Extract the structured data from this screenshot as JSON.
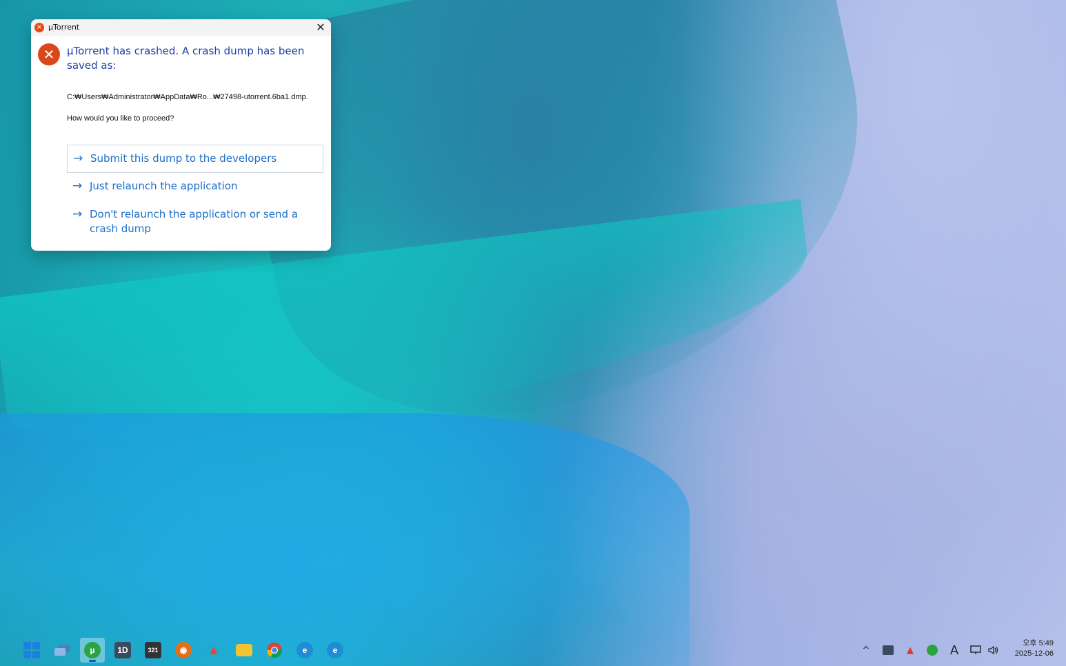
{
  "dialog": {
    "window_title": "µTorrent",
    "close_glyph": "✕",
    "heading": "µTorrent has crashed. A crash dump has been saved as:",
    "dump_path": "C:₩Users₩Administrator₩AppData₩Ro...₩27498-utorrent.6ba1.dmp.",
    "question": "How would you like to proceed?",
    "commands": [
      {
        "label": "Submit this dump to the developers"
      },
      {
        "label": "Just relaunch the application"
      },
      {
        "label": "Don't relaunch the application or send a crash dump"
      }
    ]
  },
  "taskbar": {
    "apps": [
      {
        "name": "start-menu-icon"
      },
      {
        "name": "task-view-icon"
      },
      {
        "name": "utorrent-icon",
        "glyph": "µ",
        "color": "#2aa342",
        "active": true
      },
      {
        "name": "app-1d-icon",
        "glyph": "1D",
        "color": "#3b4a5e"
      },
      {
        "name": "clapper-icon",
        "glyph": "321",
        "color": "#333333"
      },
      {
        "name": "eye-icon",
        "glyph": "◉",
        "color": "#e0701a"
      },
      {
        "name": "red-app-icon",
        "glyph": "▲",
        "color": "#e04a3a"
      },
      {
        "name": "folder-icon",
        "glyph": "▬",
        "color": "#f3c331"
      },
      {
        "name": "chrome-icon",
        "glyph": "◍",
        "color": "#db4437"
      },
      {
        "name": "edge-canary-icon",
        "glyph": "e",
        "color": "#1f8dd6"
      },
      {
        "name": "edge-canary-icon-2",
        "glyph": "e",
        "color": "#1f8dd6"
      }
    ],
    "tray": {
      "chevron": "^",
      "ime_label": "A",
      "time": "오후 5:49",
      "date": "2025-12-06"
    }
  }
}
